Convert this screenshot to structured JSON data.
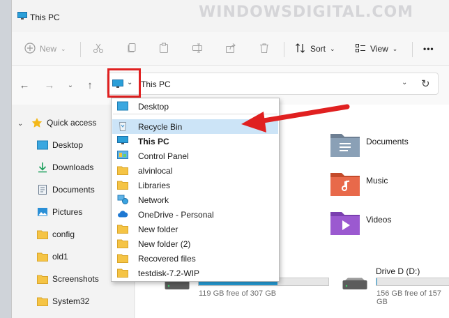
{
  "window": {
    "title": "This PC"
  },
  "watermark": "WINDOWSDIGITAL.COM",
  "toolbar": {
    "new_label": "New",
    "sort_label": "Sort",
    "view_label": "View",
    "more_label": "•••"
  },
  "address": {
    "path": "This PC"
  },
  "sidebar": {
    "items": [
      {
        "label": "Quick access",
        "icon": "star-icon"
      },
      {
        "label": "Desktop",
        "icon": "desktop-folder-icon"
      },
      {
        "label": "Downloads",
        "icon": "download-arrow-icon"
      },
      {
        "label": "Documents",
        "icon": "documents-icon"
      },
      {
        "label": "Pictures",
        "icon": "pictures-icon"
      },
      {
        "label": "config",
        "icon": "folder-icon"
      },
      {
        "label": "old1",
        "icon": "folder-icon"
      },
      {
        "label": "Screenshots",
        "icon": "folder-icon"
      },
      {
        "label": "System32",
        "icon": "folder-icon"
      }
    ]
  },
  "dropdown": {
    "items": [
      {
        "label": "Desktop",
        "icon": "desktop-folder-icon"
      },
      {
        "label": "Recycle Bin",
        "icon": "recycle-bin-icon",
        "selected": true
      },
      {
        "label": "This PC",
        "icon": "pc-icon",
        "bold": true
      },
      {
        "label": "Control Panel",
        "icon": "control-panel-icon"
      },
      {
        "label": "alvinlocal",
        "icon": "folder-icon"
      },
      {
        "label": "Libraries",
        "icon": "folder-icon"
      },
      {
        "label": "Network",
        "icon": "network-icon"
      },
      {
        "label": "OneDrive - Personal",
        "icon": "cloud-icon"
      },
      {
        "label": "New folder",
        "icon": "folder-icon"
      },
      {
        "label": "New folder (2)",
        "icon": "folder-icon"
      },
      {
        "label": "Recovered files",
        "icon": "folder-icon"
      },
      {
        "label": "testdisk-7.2-WIP",
        "icon": "folder-icon"
      }
    ]
  },
  "content": {
    "folders": [
      {
        "label": "Documents",
        "icon": "documents-folder-icon"
      },
      {
        "label": "Music",
        "icon": "music-folder-icon"
      },
      {
        "label": "Videos",
        "icon": "videos-folder-icon"
      }
    ],
    "drives": [
      {
        "name": "",
        "free_text": "119 GB free of 307 GB",
        "used_fraction": 0.61
      },
      {
        "name": "Drive D (D:)",
        "free_text": "156 GB free of 157 GB",
        "used_fraction": 0.01
      }
    ]
  },
  "colors": {
    "accent": "#26a0da",
    "highlight": "#e02020",
    "selected": "#cce4f7",
    "folder": "#f5c445"
  }
}
